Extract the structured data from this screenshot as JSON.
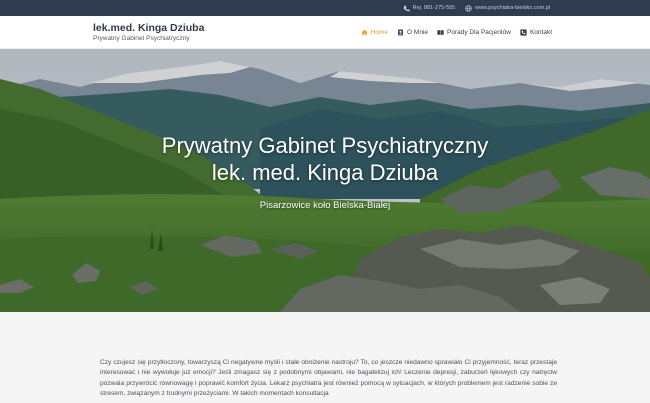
{
  "topbar": {
    "phone_icon": "phone-icon",
    "phone_text": "Rej. 881-275-555",
    "web_icon": "globe-icon",
    "web_text": "www.psychiatra-bielsko.com.pl"
  },
  "brand": {
    "title": "lek.med. Kinga Dziuba",
    "subtitle": "Prywatny Gabinet Psychiatryczny"
  },
  "nav": {
    "items": [
      {
        "label": "Home",
        "icon": "home-icon"
      },
      {
        "label": "O Mnie",
        "icon": "user-card-icon"
      },
      {
        "label": "Porady Dla Pacjentów",
        "icon": "book-icon"
      },
      {
        "label": "Kontakt",
        "icon": "phone-square-icon"
      }
    ],
    "active_color": "#f39a1c"
  },
  "hero": {
    "title_line1": "Prywatny Gabinet Psychiatryczny",
    "title_line2": "lek. med. Kinga Dziuba",
    "location": "Pisarzowice koło Bielska-Białej"
  },
  "content": {
    "paragraph": "Czy czujesz się przytłoczony, towarzyszą Ci negatywne myśli i stałe obniżenie nastroju? To, co jeszcze niedawno sprawiało Ci przyjemność, teraz przestaje interesować i nie wywołuje już emocji? Jeśli zmagasz się z podobnymi objawami, nie bagatelizuj ich! Leczenie depresji, zaburzeń lękowych czy natręctw pozwala przywrócić równowagę i poprawić komfort życia. Lekarz psychiatra jest również pomocą w sytuacjach, w których problemem jest radzenie sobie ze stresem, związanym z trudnymi przeżyciami. W takich momentach konsultacja"
  },
  "colors": {
    "topbar_bg": "#2f3b4f",
    "accent": "#f39a1c",
    "content_bg": "#f5f5f5"
  }
}
